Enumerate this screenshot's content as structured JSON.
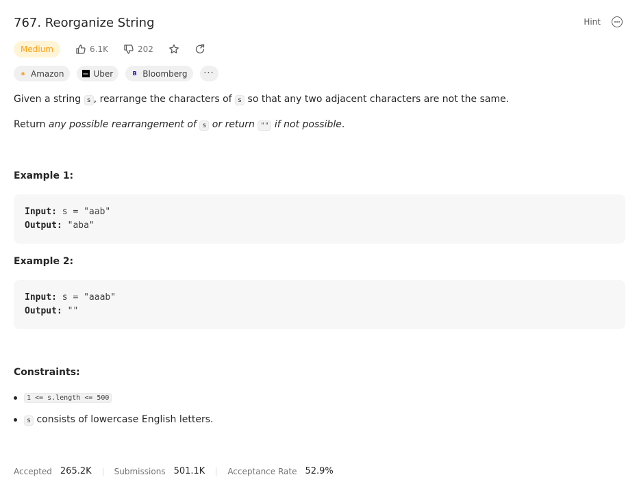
{
  "problem": {
    "title": "767. Reorganize String",
    "difficulty": "Medium",
    "likes": "6.1K",
    "dislikes": "202"
  },
  "toolbar": {
    "hint_label": "Hint"
  },
  "tags": [
    {
      "name": "Amazon",
      "color": "#ff9900"
    },
    {
      "name": "Uber",
      "color": "#000000"
    },
    {
      "name": "Bloomberg",
      "color": "#2800d7"
    }
  ],
  "tags_more": "···",
  "description": {
    "p1_a": "Given a string ",
    "p1_code1": "s",
    "p1_b": ", rearrange the characters of ",
    "p1_code2": "s",
    "p1_c": " so that any two adjacent characters are not the same.",
    "p2_a": "Return ",
    "p2_em1": "any possible rearrangement of ",
    "p2_code1": "s",
    "p2_em2": " or return ",
    "p2_code2": "\"\"",
    "p2_em3": " if not possible",
    "p2_end": "."
  },
  "examples": [
    {
      "heading": "Example 1:",
      "input_label": "Input:",
      "input": " s = \"aab\"",
      "output_label": "Output:",
      "output": " \"aba\""
    },
    {
      "heading": "Example 2:",
      "input_label": "Input:",
      "input": " s = \"aaab\"",
      "output_label": "Output:",
      "output": " \"\""
    }
  ],
  "constraints": {
    "heading": "Constraints:",
    "item1_code": "1 <= s.length <= 500",
    "item2_code": "s",
    "item2_text": " consists of lowercase English letters."
  },
  "stats": {
    "accepted_label": "Accepted",
    "accepted": "265.2K",
    "submissions_label": "Submissions",
    "submissions": "501.1K",
    "rate_label": "Acceptance Rate",
    "rate": "52.9%"
  }
}
